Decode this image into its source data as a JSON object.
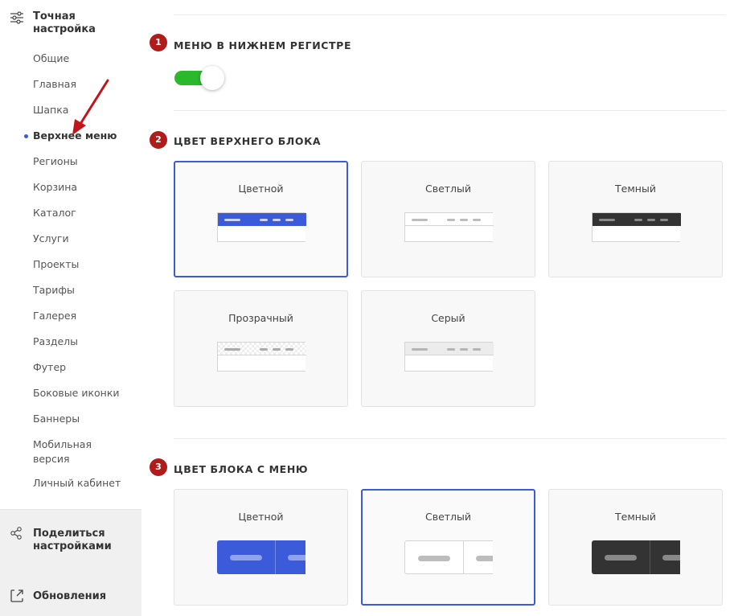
{
  "sidebar": {
    "title": "Точная настройка",
    "items": [
      {
        "label": "Общие"
      },
      {
        "label": "Главная"
      },
      {
        "label": "Шапка"
      },
      {
        "label": "Верхнее меню"
      },
      {
        "label": "Регионы"
      },
      {
        "label": "Корзина"
      },
      {
        "label": "Каталог"
      },
      {
        "label": "Услуги"
      },
      {
        "label": "Проекты"
      },
      {
        "label": "Тарифы"
      },
      {
        "label": "Галерея"
      },
      {
        "label": "Разделы"
      },
      {
        "label": "Футер"
      },
      {
        "label": "Боковые иконки"
      },
      {
        "label": "Баннеры"
      },
      {
        "label": "Мобильная версия"
      },
      {
        "label": "Личный кабинет"
      }
    ],
    "active_item": "Верхнее меню",
    "share_label": "Поделиться настройками",
    "updates_label": "Обновления"
  },
  "sections": [
    {
      "number": "1",
      "title": "МЕНЮ В НИЖНЕМ РЕГИСТРЕ",
      "toggle_on": true
    },
    {
      "number": "2",
      "title": "ЦВЕТ ВЕРХНЕГО БЛОКА",
      "options": [
        "Цветной",
        "Светлый",
        "Темный",
        "Прозрачный",
        "Серый"
      ],
      "selected": "Цветной"
    },
    {
      "number": "3",
      "title": "ЦВЕТ БЛОКА С МЕНЮ",
      "options": [
        "Цветной",
        "Светлый",
        "Темный"
      ],
      "selected": "Светлый"
    }
  ],
  "colors": {
    "accent": "#3b5bdb",
    "toggle_on": "#2cb82c",
    "badge": "#b01b1b",
    "annotation_arrow": "#c0161b"
  }
}
